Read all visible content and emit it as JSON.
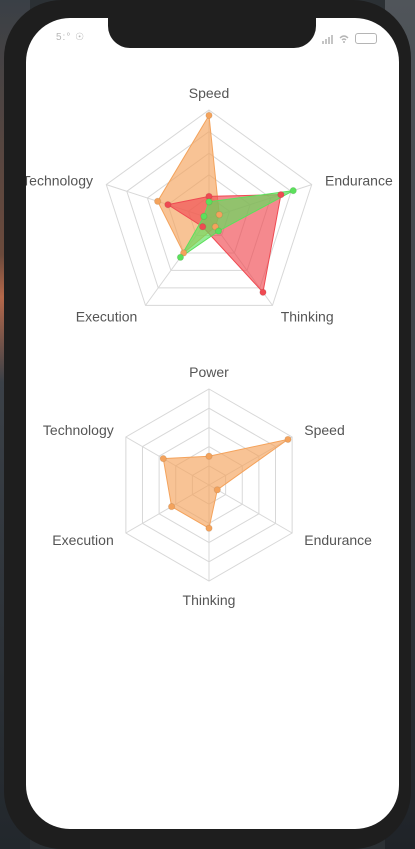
{
  "status_bar": {
    "left_text": "5:° ☉",
    "signal_icon": "cellular-signal-icon",
    "wifi_icon": "wifi-icon",
    "battery_icon": "battery-icon"
  },
  "chart_data": [
    {
      "type": "radar",
      "axes": [
        "Speed",
        "Endurance",
        "Thinking",
        "Execution",
        "Technology"
      ],
      "max": 100,
      "series": [
        {
          "color": "#f4a35c",
          "values": [
            95,
            10,
            10,
            40,
            50
          ]
        },
        {
          "color": "#ef4a52",
          "values": [
            20,
            70,
            85,
            10,
            40
          ]
        },
        {
          "color": "#5ce05c",
          "values": [
            15,
            82,
            15,
            45,
            5
          ]
        }
      ]
    },
    {
      "type": "radar",
      "axes": [
        "Power",
        "Speed",
        "Endurance",
        "Thinking",
        "Execution",
        "Technology"
      ],
      "max": 100,
      "series": [
        {
          "color": "#f4a35c",
          "values": [
            30,
            95,
            10,
            45,
            45,
            55
          ]
        }
      ]
    }
  ]
}
